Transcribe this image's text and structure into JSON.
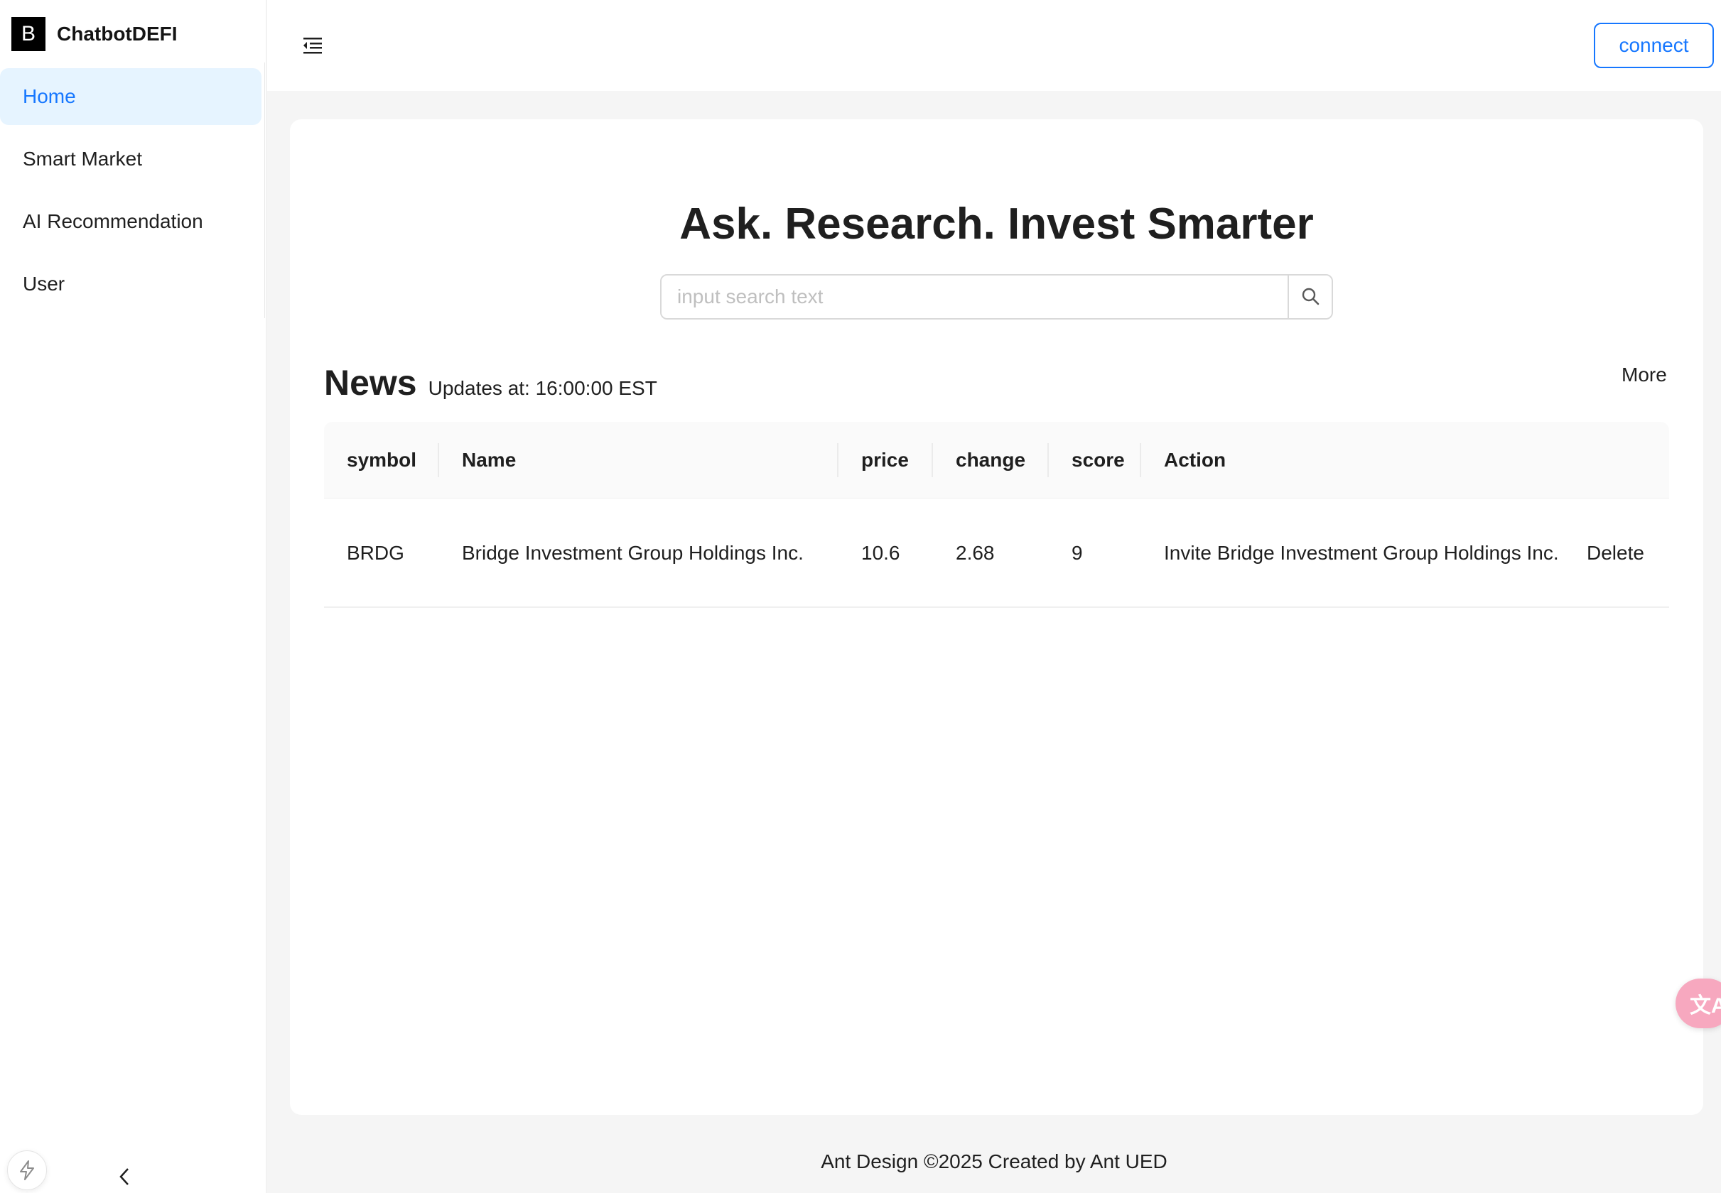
{
  "app": {
    "logo_letter": "B",
    "name": "ChatbotDEFI"
  },
  "sidebar": {
    "items": [
      {
        "label": "Home",
        "active": true
      },
      {
        "label": "Smart Market",
        "active": false
      },
      {
        "label": "AI Recommendation",
        "active": false
      },
      {
        "label": "User",
        "active": false
      }
    ]
  },
  "header": {
    "connect_label": "connect"
  },
  "hero": {
    "title": "Ask. Research. Invest Smarter",
    "search_placeholder": "input search text",
    "search_value": ""
  },
  "news": {
    "title": "News",
    "updates": "Updates at: 16:00:00 EST",
    "more_label": "More",
    "columns": [
      "symbol",
      "Name",
      "price",
      "change",
      "score",
      "Action"
    ],
    "rows": [
      {
        "symbol": "BRDG",
        "name": "Bridge Investment Group Holdings Inc.",
        "price": "10.6",
        "change": "2.68",
        "score": "9",
        "action_invite": "Invite Bridge Investment Group Holdings Inc.",
        "action_delete": "Delete"
      }
    ]
  },
  "footer": {
    "text": "Ant Design ©2025 Created by Ant UED"
  },
  "widgets": {
    "translate_glyph": "文A"
  },
  "colors": {
    "accent": "#1677ff",
    "active_menu_bg": "#e6f4ff",
    "page_bg": "#f5f5f5",
    "translate_fab": "#f7a8bf"
  }
}
